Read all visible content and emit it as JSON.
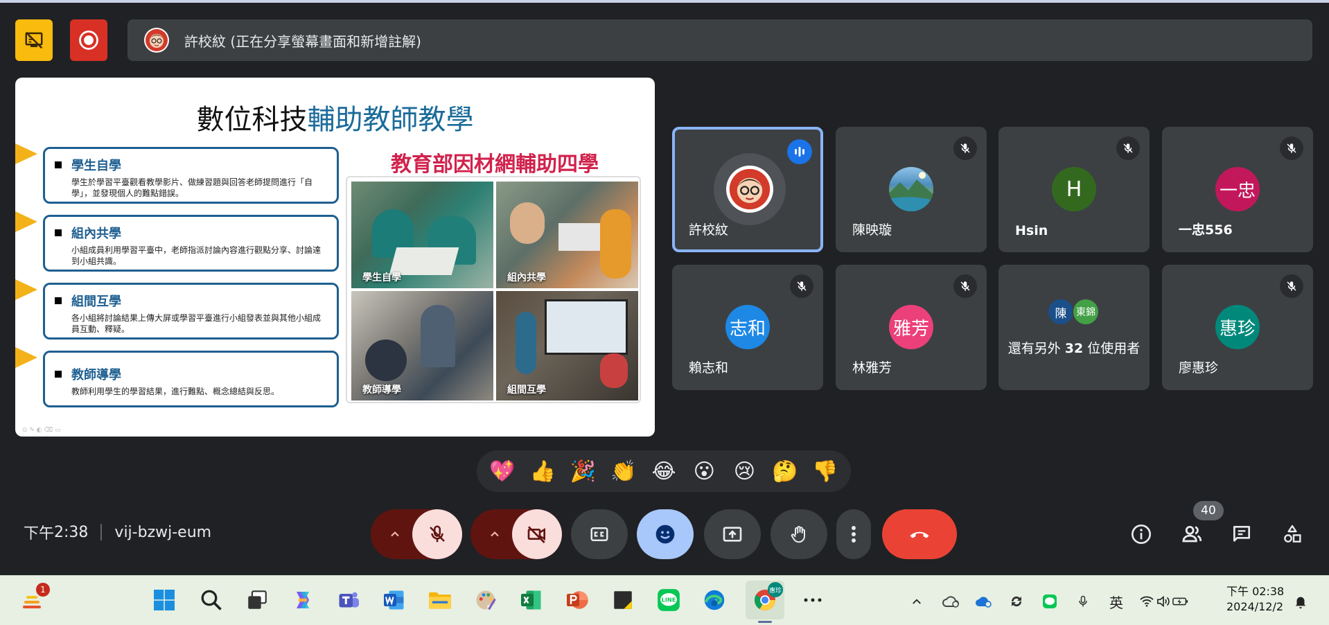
{
  "presenter_bar": {
    "text": "許校紋 (正在分享螢幕畫面和新增註解)"
  },
  "slide": {
    "title_part1": "數位科技",
    "title_part2": "輔助教師教學",
    "moe_title": "教育部因材網輔助四學",
    "items": [
      {
        "head": "學生自學",
        "desc": "學生於學習平臺觀看教學影片、做練習題與回答老師提問進行「自學」，並發現個人的難點錯誤。"
      },
      {
        "head": "組內共學",
        "desc": "小組成員利用學習平臺中，老師指派討論內容進行觀點分享、討論達到小組共識。"
      },
      {
        "head": "組間互學",
        "desc": "各小組將討論結果上傳大屏或學習平臺進行小組發表並與其他小組成員互動、釋疑。"
      },
      {
        "head": "教師導學",
        "desc": "教師利用學生的學習結果，進行難點、概念總結與反思。"
      }
    ],
    "photos": [
      {
        "caption": "學生自學"
      },
      {
        "caption": "組內共學"
      },
      {
        "caption": "教師導學"
      },
      {
        "caption": "組間互學"
      }
    ]
  },
  "participants": [
    {
      "name": "許校紋",
      "avatar": "",
      "color": "#ffffff",
      "status": "speaking"
    },
    {
      "name": "陳映璇",
      "avatar": "",
      "color": "#4e8fbf",
      "status": "muted"
    },
    {
      "name": "Hsin",
      "avatar": "H",
      "color": "#33691e",
      "status": "muted"
    },
    {
      "name": "一忠556",
      "avatar": "一忠",
      "color": "#c2185b",
      "status": "muted"
    },
    {
      "name": "賴志和",
      "avatar": "志和",
      "color": "#1e88e5",
      "status": "muted"
    },
    {
      "name": "林雅芳",
      "avatar": "雅芳",
      "color": "#ec407a",
      "status": "muted"
    },
    {
      "name": "廖惠珍",
      "avatar": "惠珍",
      "color": "#00897b",
      "status": "muted"
    }
  ],
  "others_tile": {
    "avatar1": "陳",
    "avatar2": "東錦",
    "text_pre": "還有另外 ",
    "count": "32",
    "text_post": " 位使用者"
  },
  "reactions": [
    "💖",
    "👍",
    "🎉",
    "👏",
    "😂",
    "😮",
    "😢",
    "🤔",
    "👎"
  ],
  "meeting": {
    "time_prefix": "下午",
    "time": "2:38",
    "code": "vij-bzwj-eum"
  },
  "people_count": "40",
  "taskbar": {
    "widget_badge": "1",
    "chrome_profile": "惠珍",
    "ime": "英",
    "clock_time": "下午 02:38",
    "clock_date": "2024/12/2"
  },
  "colors": {
    "background": "#202124",
    "tile": "#3c4043",
    "active_border": "#8ab4f8",
    "end_call": "#ea4335",
    "mic_off_bg": "#f9dedc",
    "expand_bg": "#601410",
    "emoji_btn": "#a8c7fa"
  }
}
